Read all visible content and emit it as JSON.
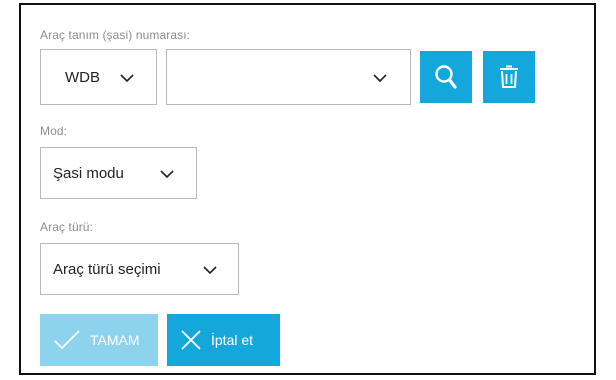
{
  "vin": {
    "label": "Araç tanım (şasi) numarası:",
    "prefix_value": "WDB",
    "number_value": ""
  },
  "mode": {
    "label": "Mod:",
    "value": "Şasi modu"
  },
  "vehicle_type": {
    "label": "Araç türü:",
    "value": "Araç türü seçimi"
  },
  "buttons": {
    "ok_label": "TAMAM",
    "cancel_label": "İptal et"
  },
  "icons": {
    "search": "search-icon",
    "delete": "trash-icon",
    "dropdown": "chevron-down-icon",
    "ok": "check-icon",
    "cancel": "close-icon"
  },
  "colors": {
    "accent": "#14a7dc",
    "accent_disabled": "#8dd3ee",
    "border": "#b8b8b8",
    "label": "#8c8c8c"
  }
}
